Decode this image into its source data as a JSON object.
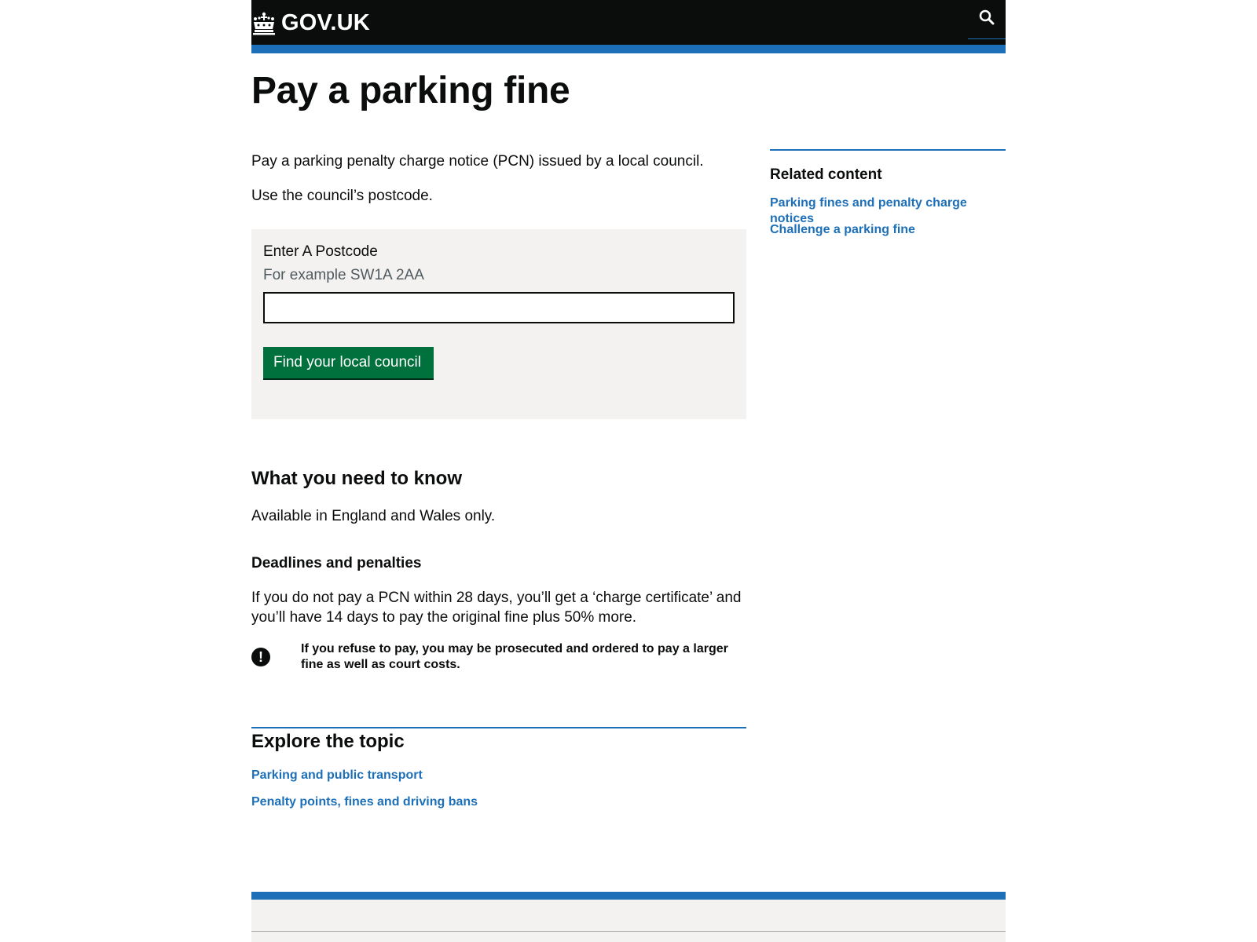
{
  "header": {
    "logo_text": "GOV.UK",
    "search_icon": "search-icon",
    "colors": {
      "header_bg": "#0b0c0c",
      "stripe": "#1d70b8"
    }
  },
  "main": {
    "title": "Pay a parking fine",
    "intro": [
      "Pay a parking penalty charge notice (PCN) issued by a local council.",
      "Use the council’s postcode."
    ],
    "form": {
      "label": "Enter A Postcode",
      "hint": "For example SW1A 2AA",
      "input_value": "",
      "button_label": "Find your local council",
      "button_color": "#00703c"
    },
    "need_to_know": {
      "heading": "What you need to know",
      "text": "Available in England and Wales only."
    },
    "deadlines": {
      "heading": "Deadlines and penalties",
      "text": "If you do not pay a PCN within 28 days, you’ll get a ‘charge certificate’ and you’ll have 14 days to pay the original fine plus 50% more.",
      "warning_icon": "!",
      "warning_text": "If you refuse to pay, you may be prosecuted and ordered to pay a larger fine as well as court costs."
    },
    "explore": {
      "heading": "Explore the topic",
      "links": [
        "Parking and public transport",
        "Penalty points, fines and driving bans"
      ]
    }
  },
  "sidebar": {
    "title": "Related content",
    "links": [
      "Parking fines and penalty charge notices",
      "Challenge a parking fine"
    ],
    "link_color": "#1d70b8"
  }
}
